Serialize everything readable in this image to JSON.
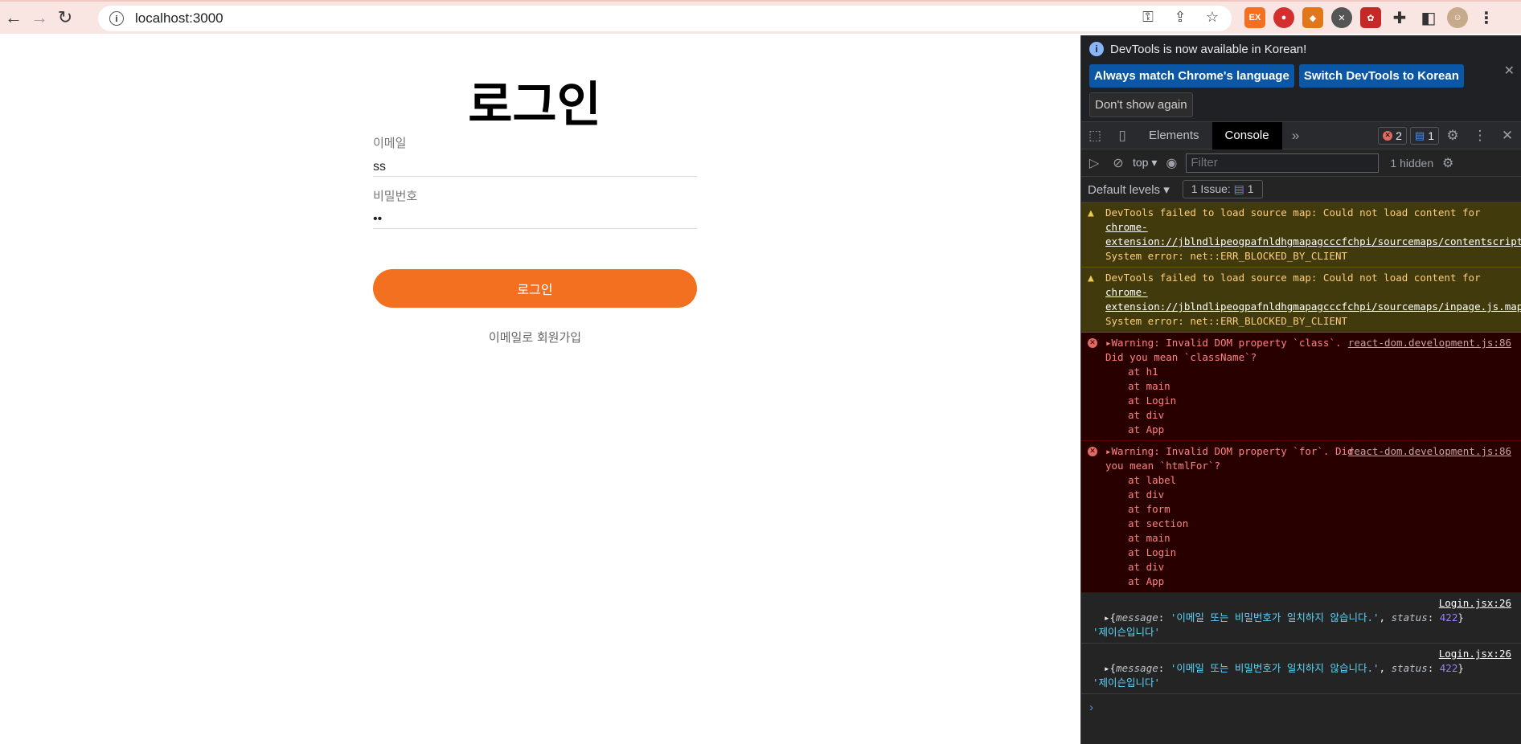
{
  "browser": {
    "url": "localhost:3000"
  },
  "page": {
    "title": "로그인",
    "email_label": "이메일",
    "email_value": "ss",
    "password_label": "비밀번호",
    "password_value": "••",
    "login_button": "로그인",
    "signup_link": "이메일로 회원가입"
  },
  "devtools": {
    "banner_text": "DevTools is now available in Korean!",
    "btn_match": "Always match Chrome's language",
    "btn_switch": "Switch DevTools to Korean",
    "btn_dismiss": "Don't show again",
    "tabs": [
      "Elements",
      "Console"
    ],
    "error_count": "2",
    "info_count": "1",
    "context": "top",
    "filter_placeholder": "Filter",
    "hidden": "1 hidden",
    "levels": "Default levels",
    "issues": "1 Issue:",
    "issues_count": "1",
    "messages": {
      "warn1_text": "DevTools failed to load source map: Could not load content for ",
      "warn1_link": "chrome-extension://jblndlipeogpafnldhgmapagcccfchpi/sourcemaps/contentscript.js.map",
      "warn1_tail": ": System error: net::ERR_BLOCKED_BY_CLIENT",
      "warn2_text": "DevTools failed to load source map: Could not load content for ",
      "warn2_link": "chrome-extension://jblndlipeogpafnldhgmapagcccfchpi/sourcemaps/inpage.js.map",
      "warn2_tail": ": System error: net::ERR_BLOCKED_BY_CLIENT",
      "err1_text": "Warning: Invalid DOM property `class`. Did you mean `className`?",
      "err1_src": "react-dom.development.js:86",
      "err1_stack": [
        "at h1",
        "at main",
        "at Login",
        "at div",
        "at App"
      ],
      "err2_text": "Warning: Invalid DOM property `for`. Did you mean `htmlFor`?",
      "err2_src": "react-dom.development.js:86",
      "err2_stack": [
        "at label",
        "at div",
        "at form",
        "at section",
        "at main",
        "at Login",
        "at div",
        "at App"
      ],
      "log_src": "Login.jsx:26",
      "log_message_key": "message",
      "log_message_val": "'이메일 또는 비밀번호가 일치하지 않습니다.'",
      "log_status_key": "status",
      "log_status_val": "422",
      "log_string": "'제이슨입니다'"
    }
  },
  "colors": {
    "accent": "#f37021",
    "toolbar": "#f9e6e3"
  }
}
